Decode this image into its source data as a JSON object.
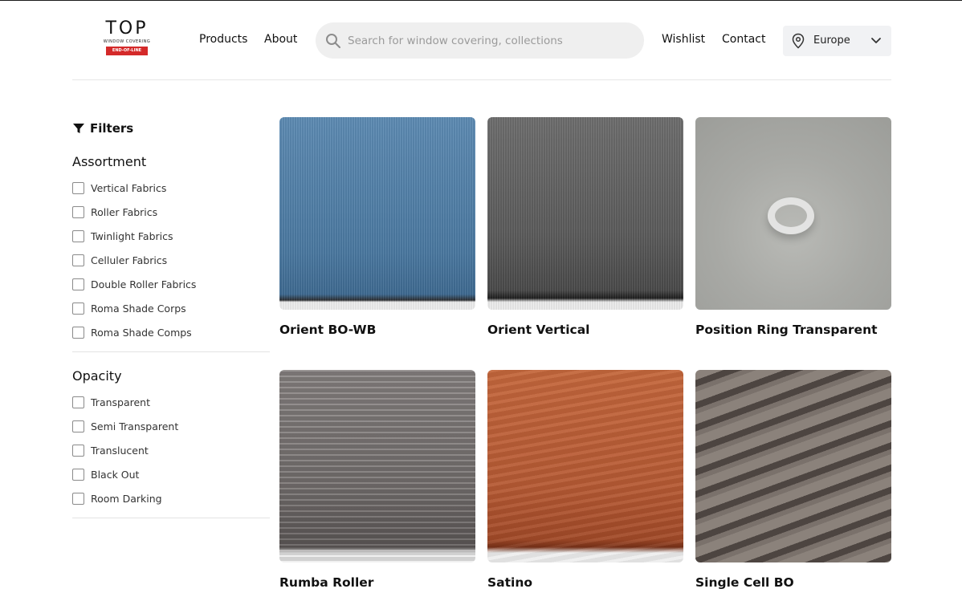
{
  "brand": {
    "logo_text": "TOP",
    "logo_subtitle": "WINDOW COVERING",
    "logo_badge": "END-OF-LINE"
  },
  "nav": {
    "products": "Products",
    "about": "About",
    "wishlist": "Wishlist",
    "contact": "Contact"
  },
  "search": {
    "placeholder": "Search for window covering, collections",
    "icon": "search-icon"
  },
  "region": {
    "selected": "Europe",
    "icon": "location-pin-icon"
  },
  "filters": {
    "title": "Filters",
    "groups": [
      {
        "title": "Assortment",
        "options": [
          "Vertical Fabrics",
          "Roller Fabrics",
          "Twinlight Fabrics",
          "Celluler Fabrics",
          "Double Roller Fabrics",
          "Roma Shade Corps",
          "Roma Shade Comps"
        ]
      },
      {
        "title": "Opacity",
        "options": [
          "Transparent",
          "Semi Transparent",
          "Translucent",
          "Black Out",
          "Room Darking"
        ]
      }
    ]
  },
  "products": [
    {
      "name": "Orient BO-WB",
      "color": "#4f7fa6"
    },
    {
      "name": "Orient Vertical",
      "color": "#5f5f5f"
    },
    {
      "name": "Position Ring Transparent",
      "color": "#a9aaa6"
    },
    {
      "name": "Rumba Roller",
      "color": "#7a7574"
    },
    {
      "name": "Satino",
      "color": "#b65a34"
    },
    {
      "name": "Single Cell BO",
      "color": "#625a55"
    }
  ]
}
